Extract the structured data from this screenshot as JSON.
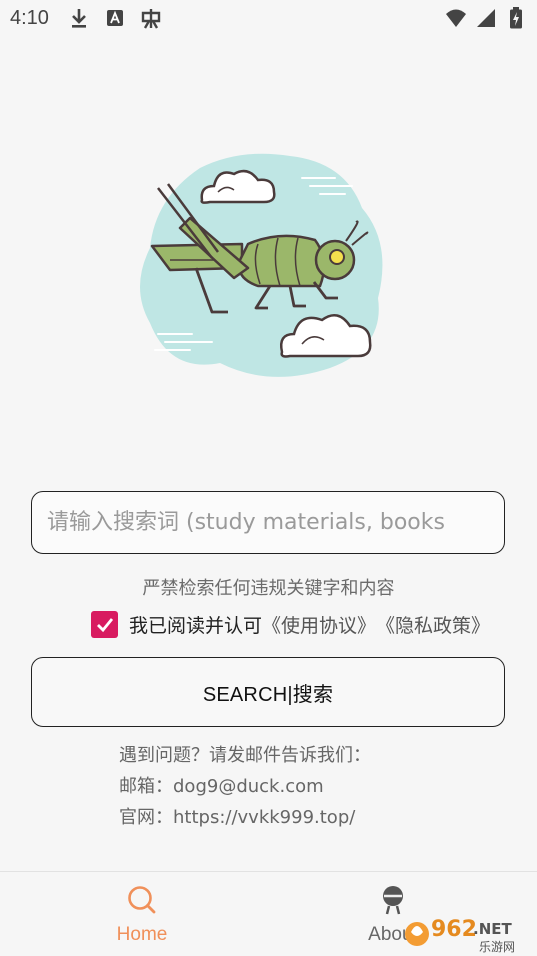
{
  "status_bar": {
    "time": "4:10",
    "left_icons": [
      "download-icon",
      "a-font-icon",
      "bug-icon"
    ],
    "right_icons": [
      "wifi-icon",
      "signal-icon",
      "battery-icon"
    ]
  },
  "search": {
    "placeholder": "请输入搜索词 (study materials, books"
  },
  "warning_text": "严禁检索任何违规关键字和内容",
  "agreement": {
    "checked": true,
    "text": "我已阅读并认可",
    "terms_link": "《使用协议》",
    "privacy_link": "《隐私政策》"
  },
  "search_button_label": "SEARCH|搜索",
  "contact": {
    "line1": "遇到问题？请发邮件告诉我们：",
    "email_line": "邮箱：dog9@duck.com",
    "website_line": "官网：https://vvkk999.top/"
  },
  "bottom_nav": {
    "home_label": "Home",
    "about_label": "About"
  },
  "watermark": {
    "text": "962.NET",
    "sub_text": "乐游网"
  },
  "colors": {
    "accent_orange": "#f0905a",
    "checkbox_pink": "#d81b60",
    "grasshopper_green": "#9bb76a",
    "cloud_blob": "#bfe6e4"
  }
}
